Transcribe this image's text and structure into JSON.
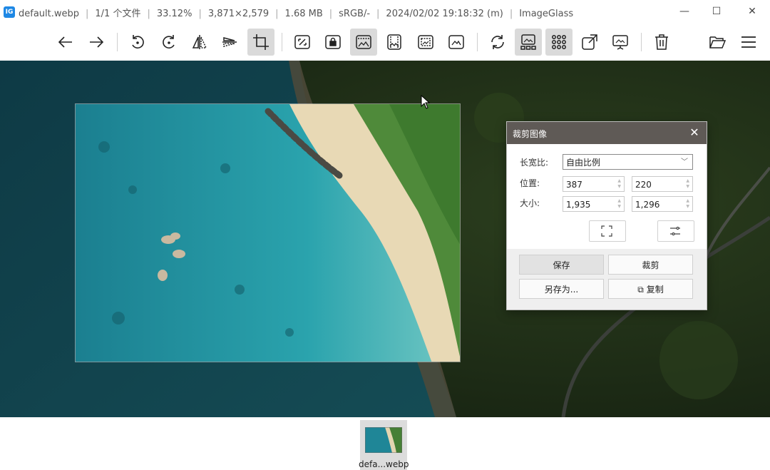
{
  "window": {
    "app_logo_text": "IG",
    "title_parts": [
      "default.webp",
      "1/1 个文件",
      "33.12%",
      "3,871×2,579",
      "1.68 MB",
      "sRGB/-",
      "2024/02/02 19:18:32 (m)",
      "ImageGlass"
    ],
    "separator": "|",
    "minimize": "—",
    "maximize": "☐",
    "close": "✕"
  },
  "toolbar": {
    "buttons": [
      {
        "name": "previous-image",
        "icon": "arrow-left-icon"
      },
      {
        "name": "next-image",
        "icon": "arrow-right-icon"
      },
      {
        "name": "rotate-left",
        "icon": "rotate-left-icon"
      },
      {
        "name": "rotate-right",
        "icon": "rotate-right-icon"
      },
      {
        "name": "flip-horizontal",
        "icon": "flip-horizontal-icon"
      },
      {
        "name": "flip-vertical",
        "icon": "flip-vertical-icon"
      },
      {
        "name": "crop",
        "icon": "crop-icon",
        "active": true
      },
      {
        "name": "auto-zoom",
        "icon": "auto-zoom-icon"
      },
      {
        "name": "lock-zoom",
        "icon": "lock-zoom-icon"
      },
      {
        "name": "scale-to-width",
        "icon": "scale-to-width-icon",
        "active": true
      },
      {
        "name": "scale-to-height",
        "icon": "scale-to-height-icon"
      },
      {
        "name": "scale-to-fit",
        "icon": "scale-to-fit-icon"
      },
      {
        "name": "scale-to-fill",
        "icon": "scale-to-fill-icon"
      },
      {
        "name": "refresh",
        "icon": "refresh-icon"
      },
      {
        "name": "toggle-gallery",
        "icon": "gallery-icon",
        "active": true
      },
      {
        "name": "toggle-checkerboard",
        "icon": "grid-icon",
        "active": true
      },
      {
        "name": "fullscreen",
        "icon": "open-external-icon"
      },
      {
        "name": "slideshow",
        "icon": "slideshow-icon"
      },
      {
        "name": "delete",
        "icon": "trash-icon"
      },
      {
        "name": "open-file",
        "icon": "folder-open-icon"
      },
      {
        "name": "main-menu",
        "icon": "hamburger-menu-icon"
      }
    ]
  },
  "crop_dialog": {
    "title": "裁剪图像",
    "aspect_label": "长宽比:",
    "aspect_value": "自由比例",
    "position_label": "位置:",
    "position_x": "387",
    "position_y": "220",
    "size_label": "大小:",
    "size_w": "1,935",
    "size_h": "1,296",
    "save_label": "保存",
    "crop_label": "裁剪",
    "save_as_label": "另存为...",
    "copy_label": "复制"
  },
  "gallery": {
    "items": [
      {
        "label": "defa...webp",
        "selected": true
      }
    ]
  },
  "colors": {
    "accent": "#1e88e5",
    "dialog_header": "#5f5a56",
    "active_button": "#dadada"
  }
}
